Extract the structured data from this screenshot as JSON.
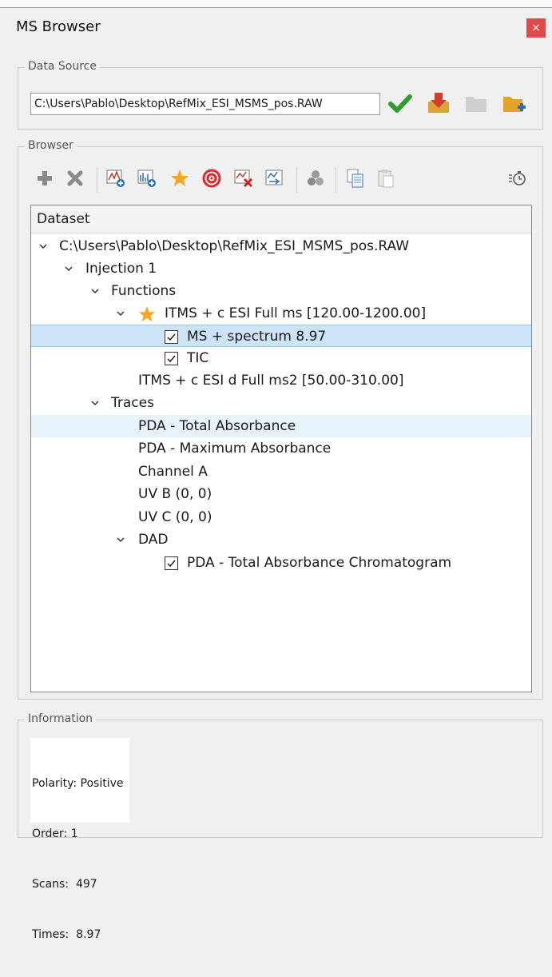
{
  "window": {
    "title": "MS Browser",
    "close_glyph": "×"
  },
  "data_source": {
    "legend": "Data Source",
    "path": "C:\\Users\\Pablo\\Desktop\\RefMix_ESI_MSMS_pos.RAW",
    "icons": [
      "check-icon",
      "download-icon",
      "folder-icon",
      "folder-add-icon"
    ]
  },
  "browser": {
    "legend": "Browser",
    "toolbar_icons": [
      "add-icon",
      "remove-icon",
      "add-chromatogram-icon",
      "add-spectrum-icon",
      "favorite-icon",
      "target-icon",
      "delete-trace-icon",
      "export-trace-icon",
      "cluster-icon",
      "copy-icon",
      "paste-icon",
      "timer-icon"
    ],
    "tree_header": "Dataset",
    "tree": {
      "root": "C:\\Users\\Pablo\\Desktop\\RefMix_ESI_MSMS_pos.RAW",
      "injection": "Injection 1",
      "functions": "Functions",
      "function_1": "ITMS + c ESI Full ms [120.00-1200.00]",
      "ms_spectrum": "MS + spectrum 8.97",
      "tic": "TIC",
      "function_2": "ITMS + c ESI d Full ms2 [50.00-310.00]",
      "traces": "Traces",
      "trace_1": "PDA - Total Absorbance",
      "trace_2": "PDA - Maximum Absorbance",
      "trace_3": "Channel A",
      "trace_4": "UV B (0, 0)",
      "trace_5": "UV C (0, 0)",
      "dad": "DAD",
      "dad_1": "PDA - Total Absorbance Chromatogram"
    }
  },
  "information": {
    "legend": "Information",
    "polarity": "Polarity: Positive",
    "order": "Order: 1",
    "scans": "Scans:  497",
    "times": "Times:  8.97"
  },
  "colors": {
    "selection": "#cce4f7",
    "close": "#e04a4a",
    "check": "#2e9e2e",
    "star": "#f5a623"
  }
}
